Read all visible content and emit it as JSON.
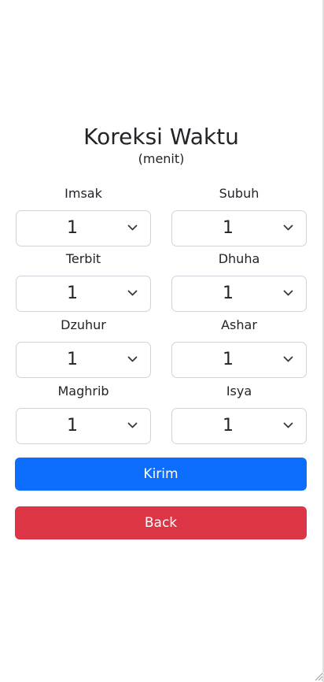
{
  "header": {
    "title": "Koreksi Waktu",
    "subtitle": "(menit)"
  },
  "fields": [
    {
      "label": "Imsak",
      "value": "1"
    },
    {
      "label": "Subuh",
      "value": "1"
    },
    {
      "label": "Terbit",
      "value": "1"
    },
    {
      "label": "Dhuha",
      "value": "1"
    },
    {
      "label": "Dzuhur",
      "value": "1"
    },
    {
      "label": "Ashar",
      "value": "1"
    },
    {
      "label": "Maghrib",
      "value": "1"
    },
    {
      "label": "Isya",
      "value": "1"
    }
  ],
  "buttons": {
    "submit_label": "Kirim",
    "back_label": "Back"
  },
  "colors": {
    "primary": "#0d6efd",
    "danger": "#dc3545",
    "border": "#ced4da",
    "text": "#212529"
  },
  "icons": {
    "select_arrow": "chevron-down-icon",
    "resize": "resize-grip-icon"
  }
}
